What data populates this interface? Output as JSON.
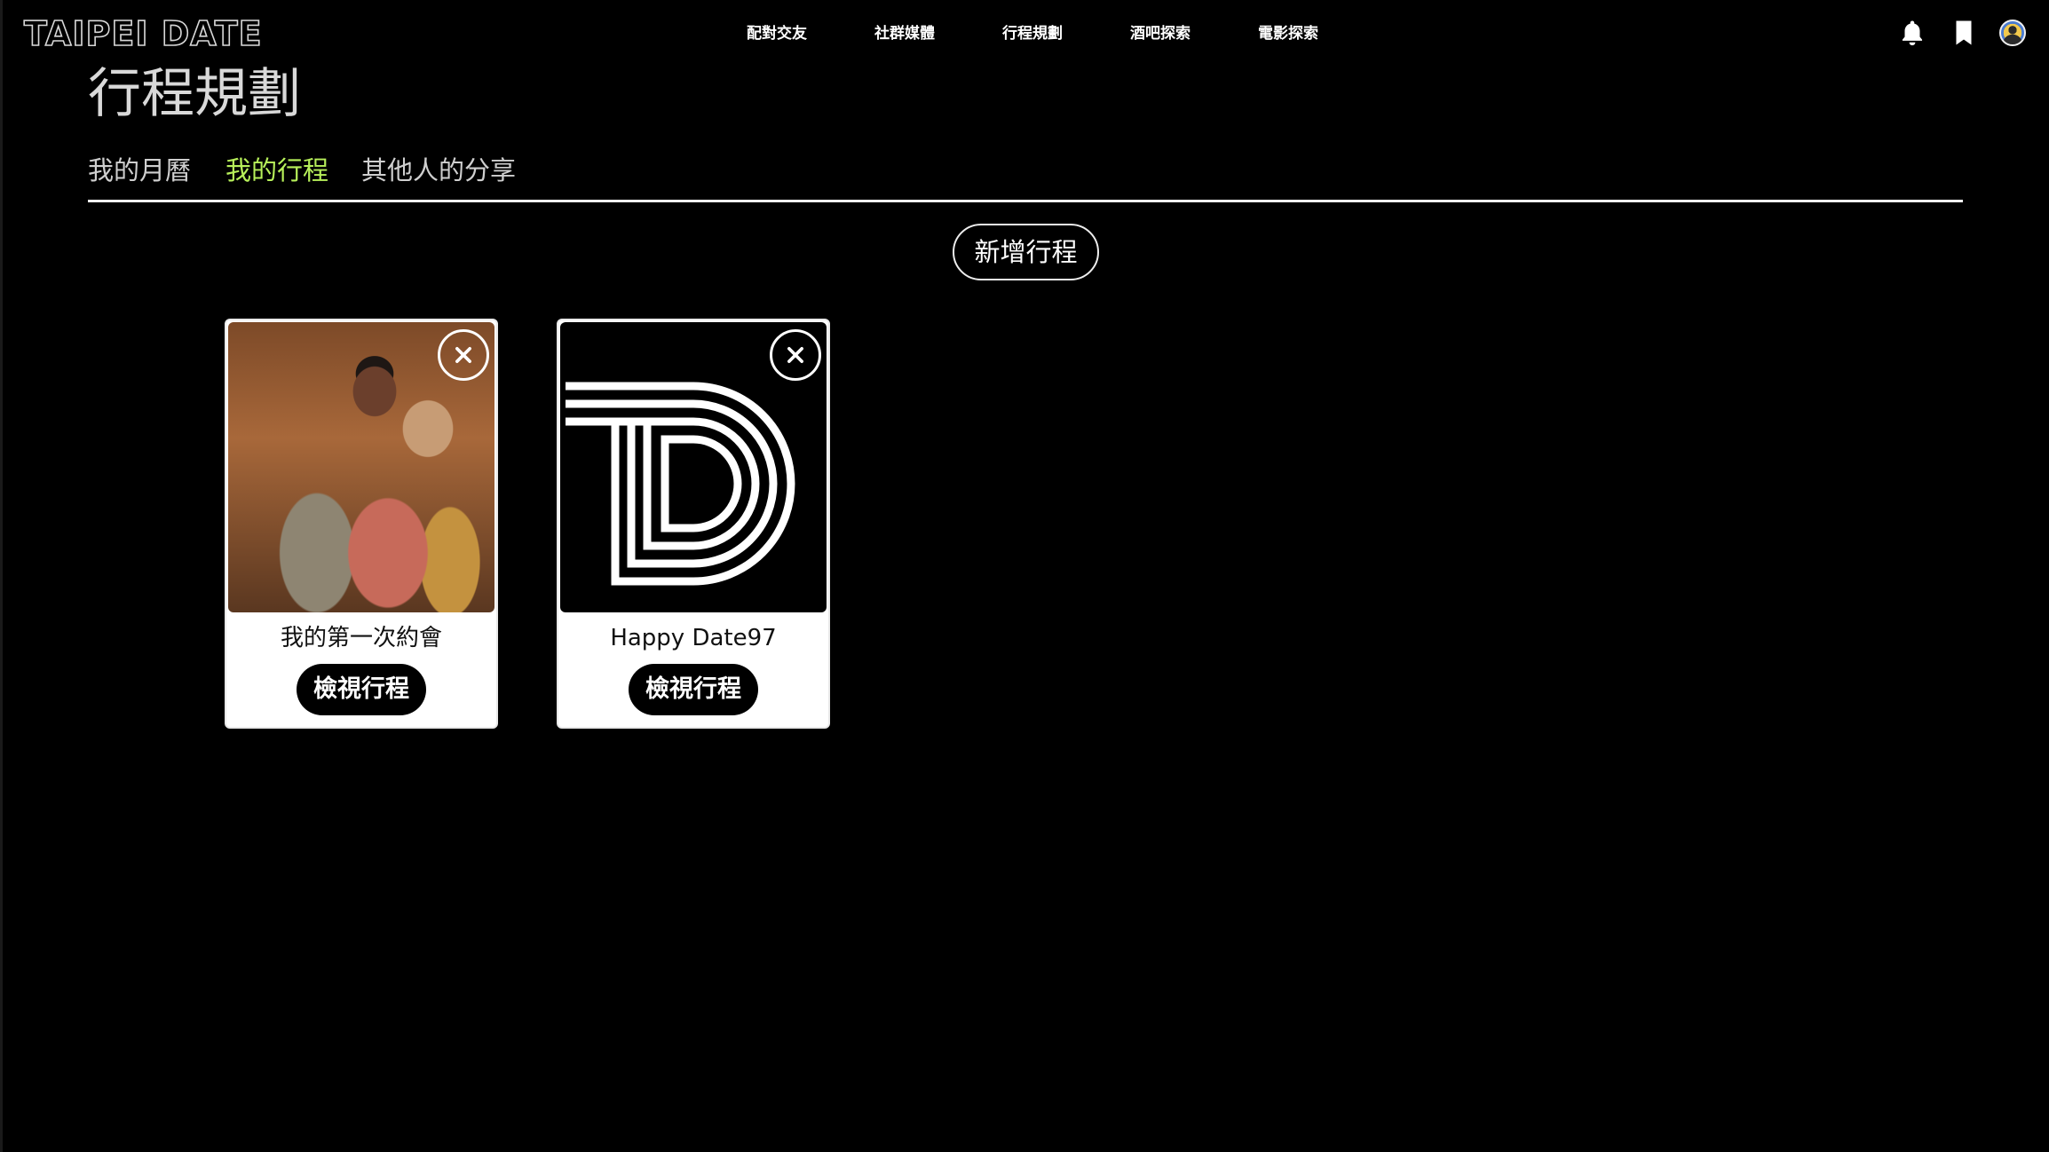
{
  "header": {
    "logo_text": "TAIPEI DATE",
    "nav": [
      "配對交友",
      "社群媒體",
      "行程規劃",
      "酒吧探索",
      "電影探索"
    ],
    "icons": [
      "bell-icon",
      "bookmark-icon",
      "avatar"
    ]
  },
  "page": {
    "title": "行程規劃",
    "tabs": [
      {
        "label": "我的月曆",
        "active": false
      },
      {
        "label": "我的行程",
        "active": true
      },
      {
        "label": "其他人的分享",
        "active": false
      }
    ],
    "active_tab_color": "#b7f05a",
    "add_button_label": "新增行程"
  },
  "cards": [
    {
      "name": "我的第一次約會",
      "image": "couple-photo",
      "view_label": "檢視行程"
    },
    {
      "name": "Happy Date97",
      "image": "td-logo",
      "view_label": "檢視行程"
    }
  ]
}
